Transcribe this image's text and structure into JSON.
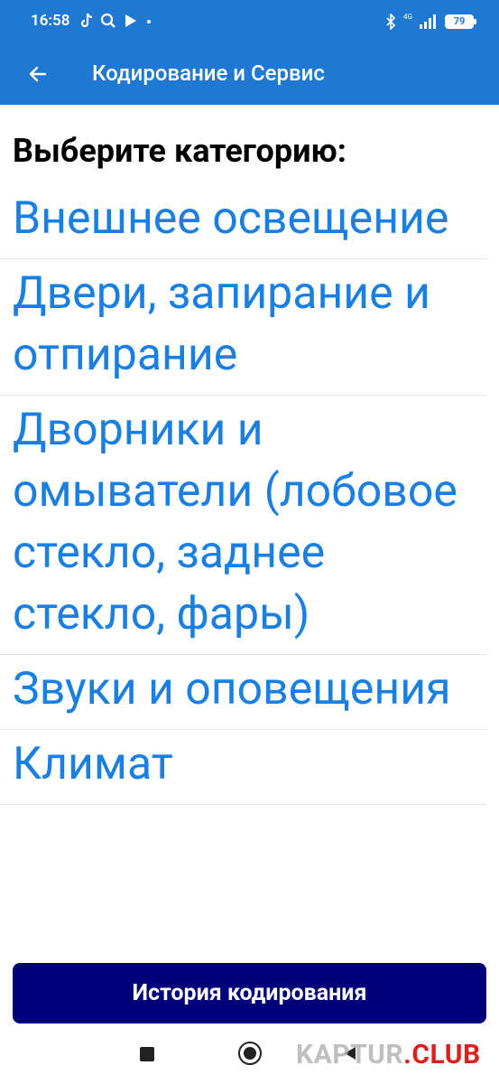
{
  "status": {
    "time": "16:58",
    "network": "4G",
    "battery": "79"
  },
  "appbar": {
    "title": "Кодирование и Сервис"
  },
  "heading": "Выберите категорию:",
  "categories": [
    {
      "label": "Внешнее освещение"
    },
    {
      "label": "Двери, запирание и отпирание"
    },
    {
      "label": "Дворники и омыватели (лобовое стекло, заднее стекло, фары)"
    },
    {
      "label": "Звуки и оповещения"
    },
    {
      "label": "Климат"
    }
  ],
  "bottom_button": {
    "label": "История кодирования"
  },
  "watermark": {
    "part1": "KAPTUR",
    "part2": ".CLUB"
  },
  "colors": {
    "primary": "#1f78d1",
    "link": "#1a7fe3",
    "button": "#00007a"
  }
}
